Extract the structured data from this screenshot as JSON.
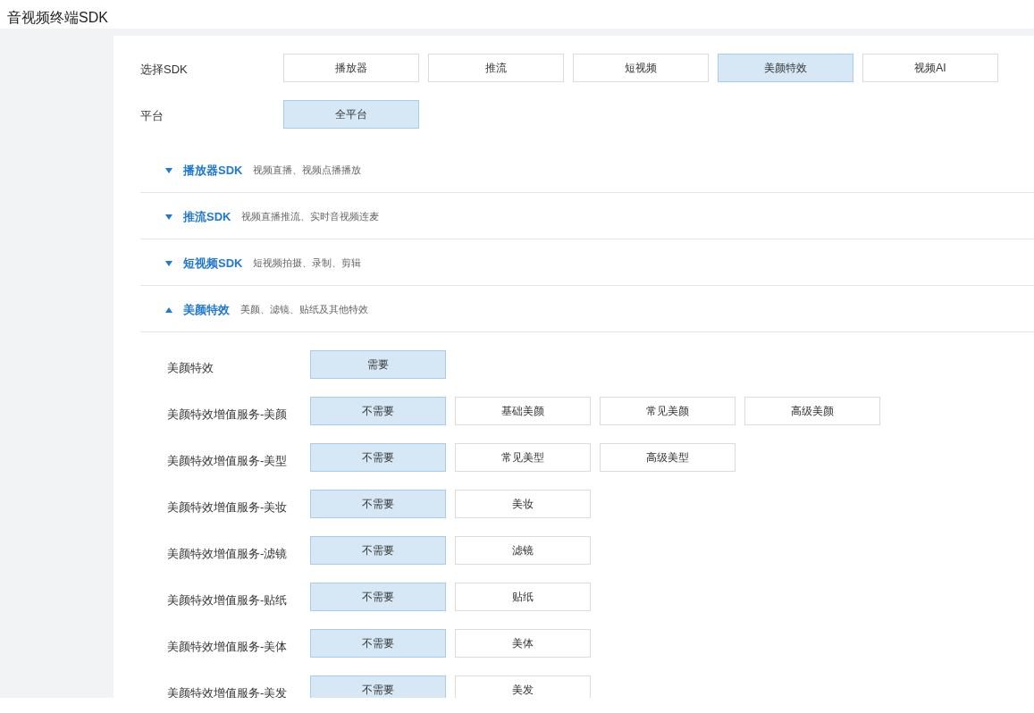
{
  "page_title": "音视频终端SDK",
  "filters": [
    {
      "label": "选择SDK",
      "options": [
        {
          "label": "播放器",
          "selected": false
        },
        {
          "label": "推流",
          "selected": false
        },
        {
          "label": "短视频",
          "selected": false
        },
        {
          "label": "美颜特效",
          "selected": true
        },
        {
          "label": "视频AI",
          "selected": false
        }
      ]
    },
    {
      "label": "平台",
      "options": [
        {
          "label": "全平台",
          "selected": true
        }
      ]
    }
  ],
  "sections": [
    {
      "title": "播放器SDK",
      "description": "视频直播、视频点播播放",
      "expanded": false
    },
    {
      "title": "推流SDK",
      "description": "视频直播推流、实时音视频连麦",
      "expanded": false
    },
    {
      "title": "短视频SDK",
      "description": "短视频拍摄、录制、剪辑",
      "expanded": false
    },
    {
      "title": "美颜特效",
      "description": "美颜、滤镜、贴纸及其他特效",
      "expanded": true,
      "options": [
        {
          "label": "美颜特效",
          "options": [
            {
              "label": "需要",
              "selected": true
            }
          ]
        },
        {
          "label": "美颜特效增值服务-美颜",
          "options": [
            {
              "label": "不需要",
              "selected": true
            },
            {
              "label": "基础美颜",
              "selected": false
            },
            {
              "label": "常见美颜",
              "selected": false
            },
            {
              "label": "高级美颜",
              "selected": false
            }
          ]
        },
        {
          "label": "美颜特效增值服务-美型",
          "options": [
            {
              "label": "不需要",
              "selected": true
            },
            {
              "label": "常见美型",
              "selected": false
            },
            {
              "label": "高级美型",
              "selected": false
            }
          ]
        },
        {
          "label": "美颜特效增值服务-美妆",
          "options": [
            {
              "label": "不需要",
              "selected": true
            },
            {
              "label": "美妆",
              "selected": false
            }
          ]
        },
        {
          "label": "美颜特效增值服务-滤镜",
          "options": [
            {
              "label": "不需要",
              "selected": true
            },
            {
              "label": "滤镜",
              "selected": false
            }
          ]
        },
        {
          "label": "美颜特效增值服务-贴纸",
          "options": [
            {
              "label": "不需要",
              "selected": true
            },
            {
              "label": "贴纸",
              "selected": false
            }
          ]
        },
        {
          "label": "美颜特效增值服务-美体",
          "options": [
            {
              "label": "不需要",
              "selected": true
            },
            {
              "label": "美体",
              "selected": false
            }
          ]
        },
        {
          "label": "美颜特效增值服务-美发",
          "options": [
            {
              "label": "不需要",
              "selected": true
            },
            {
              "label": "美发",
              "selected": false
            }
          ]
        }
      ]
    }
  ]
}
